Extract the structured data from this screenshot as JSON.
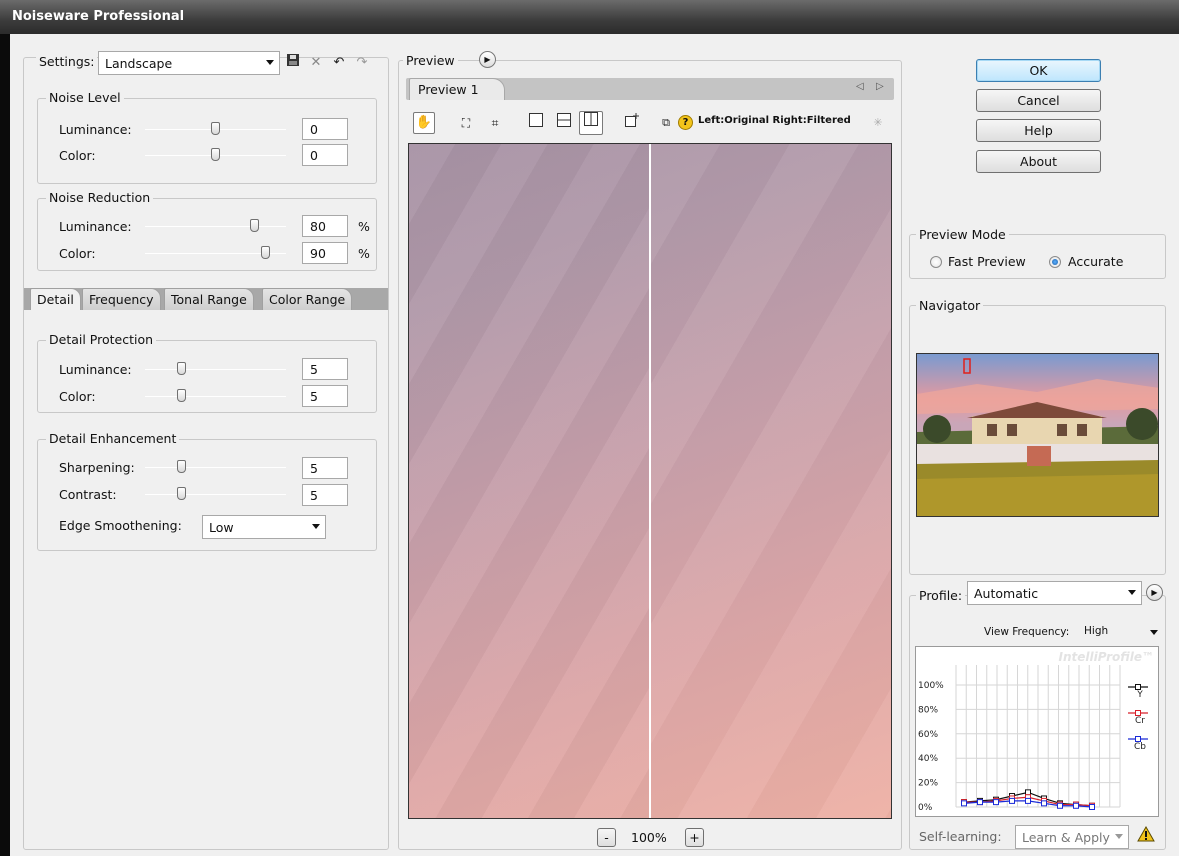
{
  "window": {
    "title": "Noiseware Professional"
  },
  "settings": {
    "label": "Settings:",
    "value": "Landscape"
  },
  "noise_level": {
    "legend": "Noise Level",
    "luminance": {
      "label": "Luminance:",
      "value": "0",
      "level": 0.5
    },
    "color": {
      "label": "Color:",
      "value": "0",
      "level": 0.5
    }
  },
  "noise_reduction": {
    "legend": "Noise Reduction",
    "luminance": {
      "label": "Luminance:",
      "value": "80",
      "unit": "%",
      "level": 0.8
    },
    "color": {
      "label": "Color:",
      "value": "90",
      "unit": "%",
      "level": 0.9
    }
  },
  "tabs": [
    "Detail",
    "Frequency",
    "Tonal Range",
    "Color Range"
  ],
  "detail_protection": {
    "legend": "Detail Protection",
    "luminance": {
      "label": "Luminance:",
      "value": "5",
      "level": 0.25
    },
    "color": {
      "label": "Color:",
      "value": "5",
      "level": 0.25
    }
  },
  "detail_enhancement": {
    "legend": "Detail Enhancement",
    "sharpening": {
      "label": "Sharpening:",
      "value": "5",
      "level": 0.25
    },
    "contrast": {
      "label": "Contrast:",
      "value": "5",
      "level": 0.25
    },
    "edge_smoothening": {
      "label": "Edge Smoothening:",
      "value": "Low"
    }
  },
  "preview": {
    "legend": "Preview",
    "tab": "Preview 1",
    "split_label": "Left:Original Right:Filtered",
    "zoom": "100%",
    "zoom_out": "-",
    "zoom_in": "+"
  },
  "buttons": {
    "ok": "OK",
    "cancel": "Cancel",
    "help": "Help",
    "about": "About"
  },
  "preview_mode": {
    "legend": "Preview Mode",
    "fast": "Fast Preview",
    "accurate": "Accurate",
    "selected": "accurate"
  },
  "navigator": {
    "legend": "Navigator"
  },
  "profile": {
    "label": "Profile:",
    "value": "Automatic",
    "view_frequency_label": "View Frequency:",
    "view_frequency": "High",
    "brand": "IntelliProfile™",
    "y_ticks": [
      "100%",
      "80%",
      "60%",
      "40%",
      "20%",
      "0%"
    ],
    "legend_items": [
      {
        "name": "Y",
        "color": "#111111"
      },
      {
        "name": "Cr",
        "color": "#d8202a"
      },
      {
        "name": "Cb",
        "color": "#1a2ad8"
      }
    ],
    "series": {
      "Y": [
        4,
        5,
        6,
        9,
        12,
        7,
        3,
        2,
        1
      ],
      "Cr": [
        4,
        4,
        5,
        7,
        8,
        5,
        2,
        2,
        1
      ],
      "Cb": [
        3,
        4,
        4,
        5,
        5,
        3,
        1,
        1,
        0
      ]
    },
    "self_learning_label": "Self-learning:",
    "self_learning_value": "Learn & Apply"
  },
  "colors": {
    "default_button": "#3c7fb1",
    "graph_y": "#111111",
    "graph_cr": "#d8202a",
    "graph_cb": "#1a2ad8"
  }
}
